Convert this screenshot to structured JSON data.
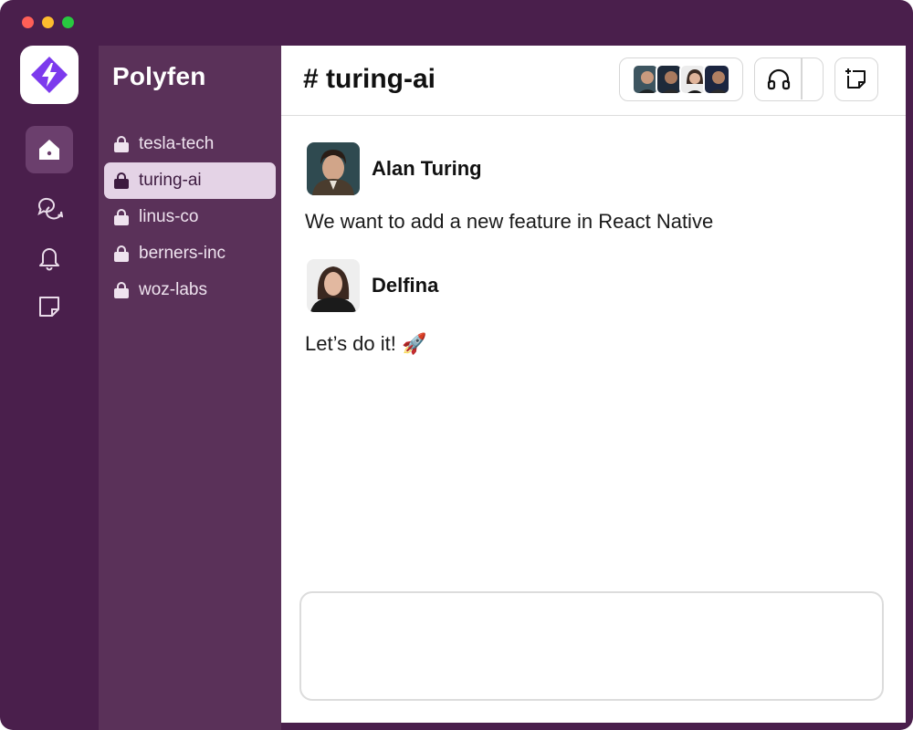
{
  "window": {
    "traffic_lights": [
      "#ff5f57",
      "#febc2e",
      "#28c840"
    ]
  },
  "rail": {
    "logo_icon": "polyfen-logo-icon",
    "items": [
      {
        "icon": "home-icon",
        "active": true
      },
      {
        "icon": "chat-bubbles-icon",
        "active": false
      },
      {
        "icon": "bell-icon",
        "active": false
      },
      {
        "icon": "note-icon",
        "active": false
      }
    ]
  },
  "sidebar": {
    "workspace": "Polyfen",
    "channels": [
      {
        "label": "tesla-tech",
        "active": false
      },
      {
        "label": "turing-ai",
        "active": true
      },
      {
        "label": "linus-co",
        "active": false
      },
      {
        "label": "berners-inc",
        "active": false
      },
      {
        "label": "woz-labs",
        "active": false
      }
    ]
  },
  "header": {
    "title": "# turing-ai",
    "members_count_shown": 4,
    "huddle_icon": "headphones-icon",
    "canvas_icon": "new-canvas-icon"
  },
  "messages": [
    {
      "author": "Alan Turing",
      "text": "We want to add a new feature in React Native"
    },
    {
      "author": "Delfina",
      "text": "Let’s do it! 🚀"
    }
  ],
  "composer": {
    "value": "",
    "placeholder": ""
  },
  "colors": {
    "frame": "#4a1f4c",
    "sidebar": "#5a3159",
    "active_channel": "#e4d3e6",
    "brand_purple": "#7c3aed"
  }
}
